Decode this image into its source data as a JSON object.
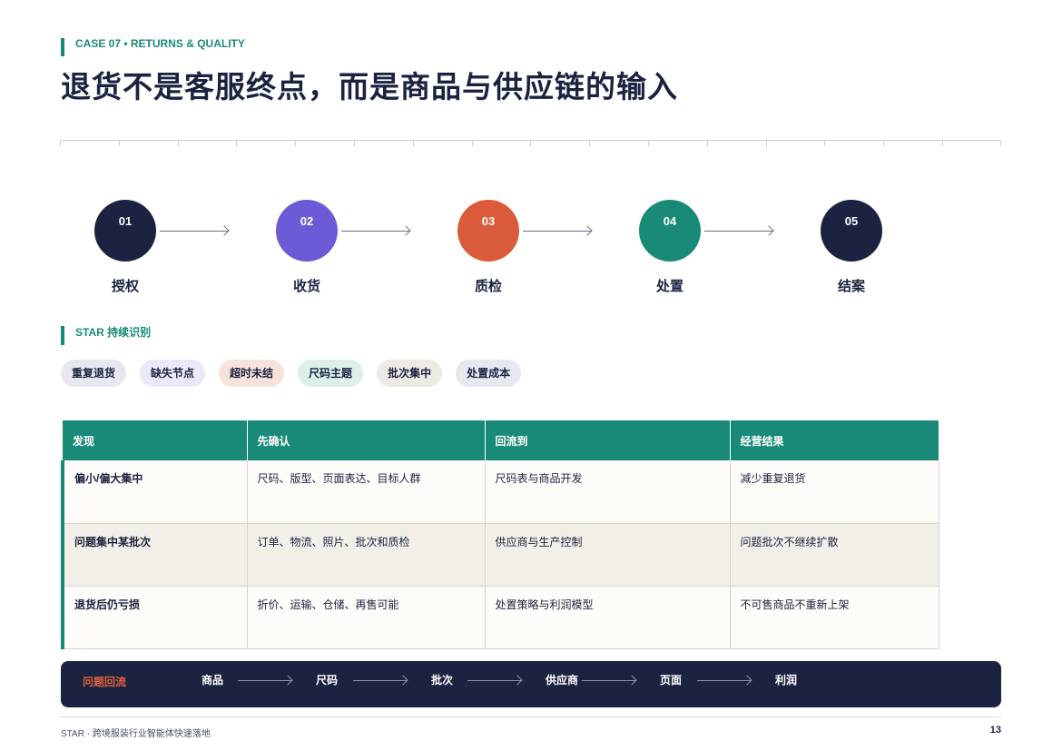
{
  "kicker": "CASE 07 • RETURNS & QUALITY",
  "title": "退货不是客服终点，而是商品与供应链的输入",
  "steps": [
    {
      "num": "01",
      "label": "授权",
      "color": "#1b2340"
    },
    {
      "num": "02",
      "label": "收货",
      "color": "#6b5bd6"
    },
    {
      "num": "03",
      "label": "质检",
      "color": "#d95b3a"
    },
    {
      "num": "04",
      "label": "处置",
      "color": "#1a8a78"
    },
    {
      "num": "05",
      "label": "结案",
      "color": "#1b2340"
    }
  ],
  "section_title": "STAR 持续识别",
  "chips": [
    {
      "label": "重复退货",
      "color": "#e6e8f0"
    },
    {
      "label": "缺失节点",
      "color": "#ebe8f8"
    },
    {
      "label": "超时未结",
      "color": "#f7e3db"
    },
    {
      "label": "尺码主题",
      "color": "#dcefe9"
    },
    {
      "label": "批次集中",
      "color": "#ede9e3"
    },
    {
      "label": "处置成本",
      "color": "#e6e8f0"
    }
  ],
  "table": {
    "headers": [
      "发现",
      "先确认",
      "回流到",
      "经营结果"
    ],
    "rows": [
      [
        "偏小/偏大集中",
        "尺码、版型、页面表达、目标人群",
        "尺码表与商品开发",
        "减少重复退货"
      ],
      [
        "问题集中某批次",
        "订单、物流、照片、批次和质检",
        "供应商与生产控制",
        "问题批次不继续扩散"
      ],
      [
        "退货后仍亏损",
        "折价、运输、仓储、再售可能",
        "处置策略与利润模型",
        "不可售商品不重新上架"
      ]
    ]
  },
  "flow": {
    "label": "问题回流",
    "items": [
      "商品",
      "尺码",
      "批次",
      "供应商",
      "页面",
      "利润"
    ]
  },
  "footer": {
    "left": "STAR · 跨境服装行业智能体快速落地",
    "page": "13"
  },
  "colors": {
    "accent": "#1a8a78",
    "navy": "#1b2340",
    "orange": "#e0603c"
  }
}
